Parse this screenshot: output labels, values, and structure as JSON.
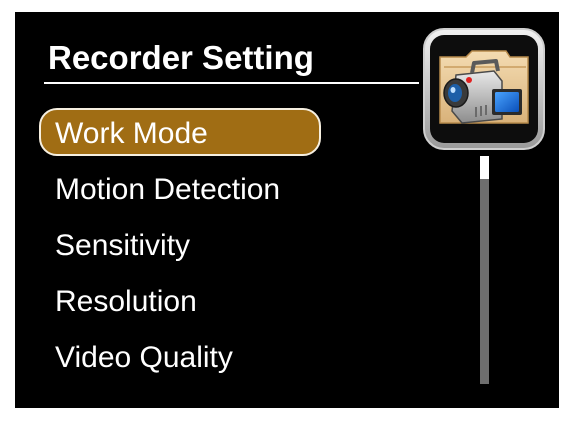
{
  "header": {
    "title": "Recorder Setting",
    "icon": "camcorder-folder-icon"
  },
  "menu": {
    "items": [
      {
        "label": "Work Mode",
        "selected": true
      },
      {
        "label": "Motion Detection",
        "selected": false
      },
      {
        "label": "Sensitivity",
        "selected": false
      },
      {
        "label": "Resolution",
        "selected": false
      },
      {
        "label": "Video Quality",
        "selected": false
      }
    ]
  },
  "scrollbar": {
    "position_fraction": 0.0,
    "visible_fraction": 0.1
  },
  "colors": {
    "background": "#000000",
    "text": "#ffffff",
    "selection_fill": "#a06d14",
    "selection_border": "#f6efe0",
    "scroll_track": "#6e6e6e",
    "scroll_thumb": "#ffffff"
  }
}
